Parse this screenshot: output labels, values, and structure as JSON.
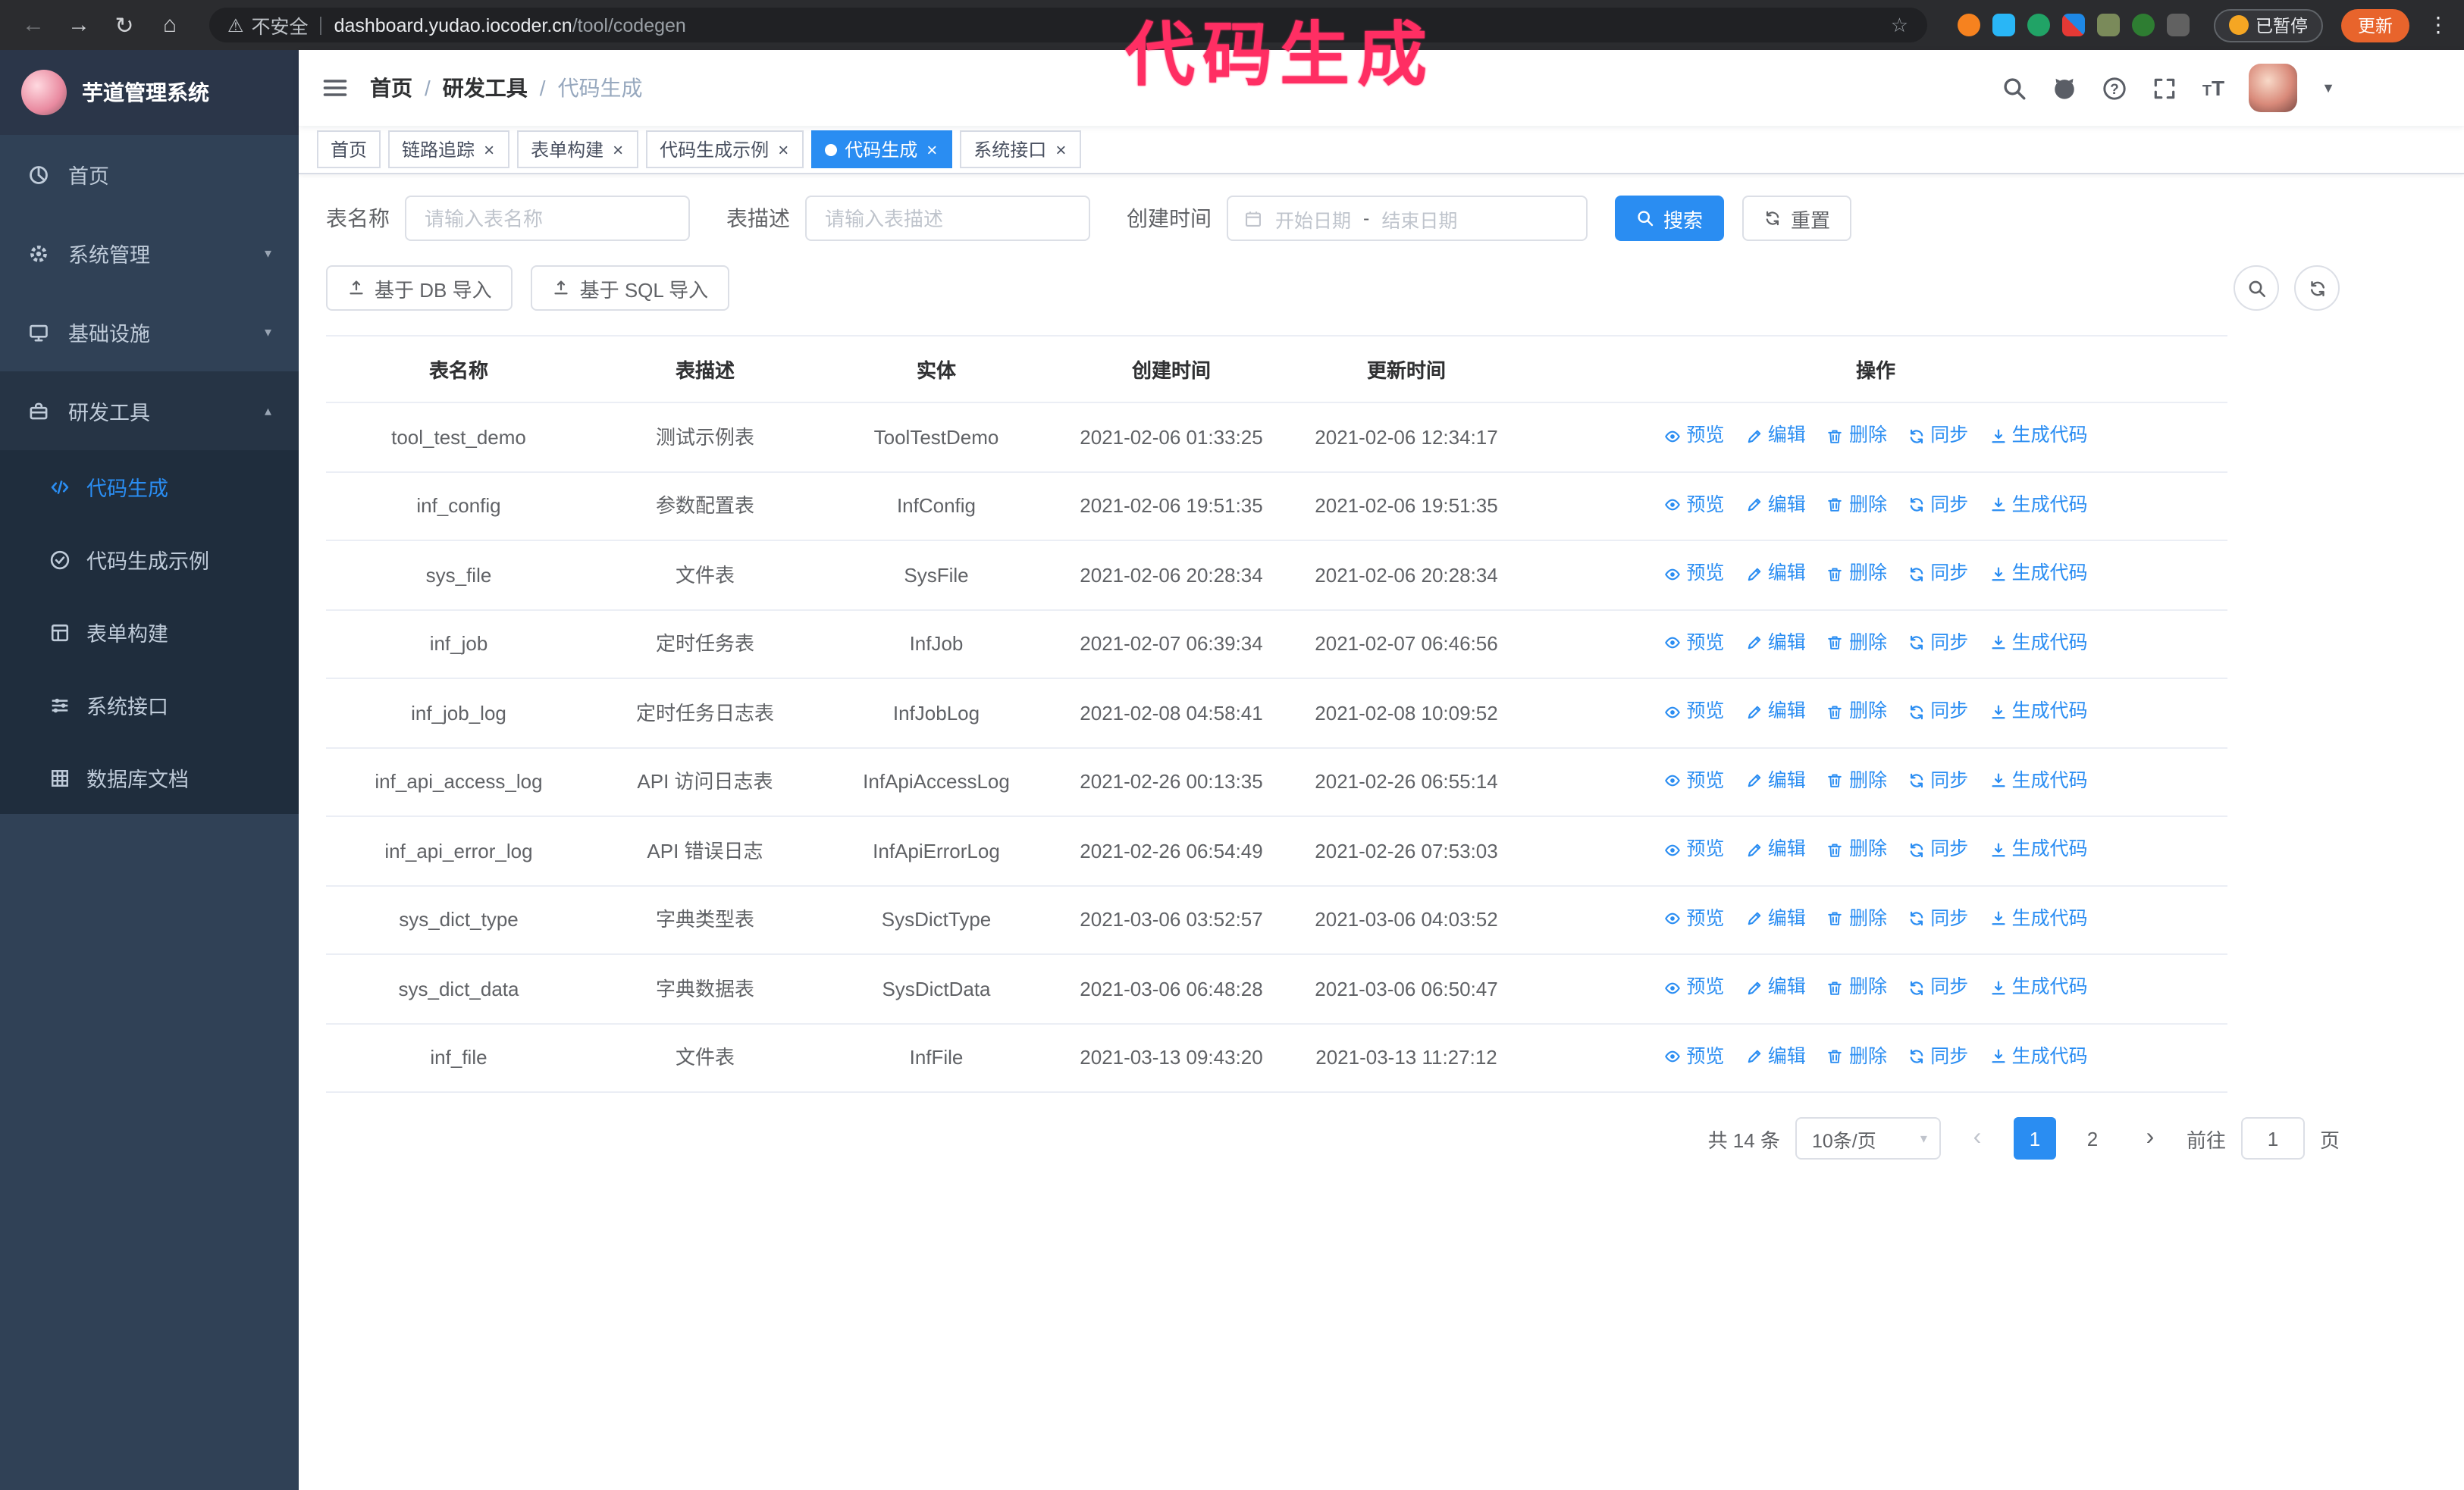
{
  "colors": {
    "accent": "#2a8df2",
    "sidebar-bg": "#304156",
    "sidebar-sub-bg": "#1f2d3d",
    "annotation": "#ff2e63",
    "update-btn": "#e8642c",
    "paused-emoji": "#f5a623"
  },
  "browser": {
    "security_label": "不安全",
    "url_host": "dashboard.yudao.iocoder.cn",
    "url_path": "/tool/codegen",
    "paused_badge": "已暂停",
    "update_button": "更新"
  },
  "annotation": {
    "text": "代码生成"
  },
  "sidebar": {
    "title": "芋道管理系统",
    "menu": [
      {
        "label": "首页"
      },
      {
        "label": "系统管理"
      },
      {
        "label": "基础设施"
      },
      {
        "label": "研发工具"
      }
    ],
    "submenu": [
      {
        "label": "代码生成"
      },
      {
        "label": "代码生成示例"
      },
      {
        "label": "表单构建"
      },
      {
        "label": "系统接口"
      },
      {
        "label": "数据库文档"
      }
    ]
  },
  "breadcrumb": {
    "items": [
      "首页",
      "研发工具",
      "代码生成"
    ],
    "separator": "/"
  },
  "tabs": [
    {
      "label": "首页"
    },
    {
      "label": "链路追踪"
    },
    {
      "label": "表单构建"
    },
    {
      "label": "代码生成示例"
    },
    {
      "label": "代码生成"
    },
    {
      "label": "系统接口"
    }
  ],
  "filters": {
    "name_label": "表名称",
    "name_placeholder": "请输入表名称",
    "desc_label": "表描述",
    "desc_placeholder": "请输入表描述",
    "time_label": "创建时间",
    "start_placeholder": "开始日期",
    "separator": "-",
    "end_placeholder": "结束日期",
    "search": "搜索",
    "reset": "重置"
  },
  "toolbar": {
    "import_db": "基于 DB 导入",
    "import_sql": "基于 SQL 导入"
  },
  "table": {
    "columns": [
      "表名称",
      "表描述",
      "实体",
      "创建时间",
      "更新时间",
      "操作"
    ],
    "actions": [
      "预览",
      "编辑",
      "删除",
      "同步",
      "生成代码"
    ],
    "rows": [
      {
        "name": "tool_test_demo",
        "desc": "测试示例表",
        "entity": "ToolTestDemo",
        "created": "2021-02-06 01:33:25",
        "updated": "2021-02-06 12:34:17"
      },
      {
        "name": "inf_config",
        "desc": "参数配置表",
        "entity": "InfConfig",
        "created": "2021-02-06 19:51:35",
        "updated": "2021-02-06 19:51:35"
      },
      {
        "name": "sys_file",
        "desc": "文件表",
        "entity": "SysFile",
        "created": "2021-02-06 20:28:34",
        "updated": "2021-02-06 20:28:34"
      },
      {
        "name": "inf_job",
        "desc": "定时任务表",
        "entity": "InfJob",
        "created": "2021-02-07 06:39:34",
        "updated": "2021-02-07 06:46:56"
      },
      {
        "name": "inf_job_log",
        "desc": "定时任务日志表",
        "entity": "InfJobLog",
        "created": "2021-02-08 04:58:41",
        "updated": "2021-02-08 10:09:52"
      },
      {
        "name": "inf_api_access_log",
        "desc": "API 访问日志表",
        "entity": "InfApiAccessLog",
        "created": "2021-02-26 00:13:35",
        "updated": "2021-02-26 06:55:14"
      },
      {
        "name": "inf_api_error_log",
        "desc": "API 错误日志",
        "entity": "InfApiErrorLog",
        "created": "2021-02-26 06:54:49",
        "updated": "2021-02-26 07:53:03"
      },
      {
        "name": "sys_dict_type",
        "desc": "字典类型表",
        "entity": "SysDictType",
        "created": "2021-03-06 03:52:57",
        "updated": "2021-03-06 04:03:52"
      },
      {
        "name": "sys_dict_data",
        "desc": "字典数据表",
        "entity": "SysDictData",
        "created": "2021-03-06 06:48:28",
        "updated": "2021-03-06 06:50:47"
      },
      {
        "name": "inf_file",
        "desc": "文件表",
        "entity": "InfFile",
        "created": "2021-03-13 09:43:20",
        "updated": "2021-03-13 11:27:12"
      }
    ]
  },
  "pagination": {
    "total": "共 14 条",
    "page_size": "10条/页",
    "pages": [
      "1",
      "2"
    ],
    "goto_label": "前往",
    "goto_value": "1",
    "goto_unit": "页"
  }
}
